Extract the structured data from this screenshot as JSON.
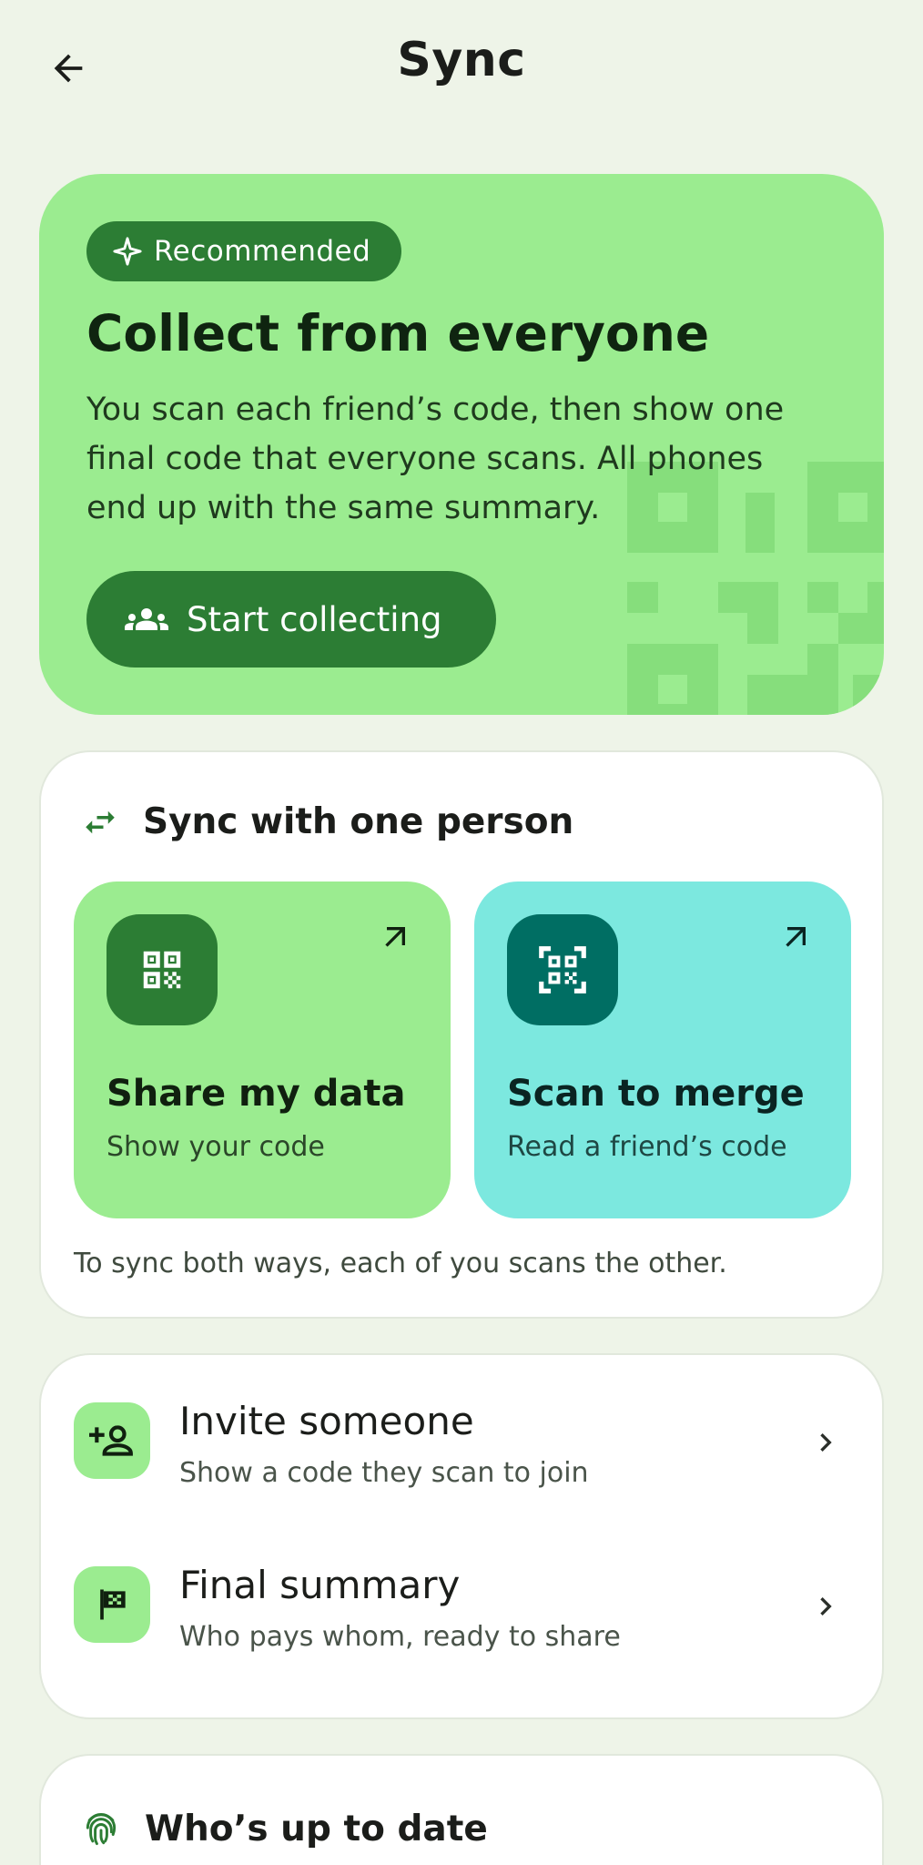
{
  "header": {
    "title": "Sync",
    "back_icon": "arrow-left-icon"
  },
  "hero": {
    "badge": "Recommended",
    "badge_icon": "sparkle-icon",
    "title": "Collect from everyone",
    "description": "You scan each friend’s code, then show one final code that everyone scans. All phones end up with the same summary.",
    "button_label": "Start collecting",
    "button_icon": "group-icon",
    "background_color": "#9BEC90",
    "accent_color": "#2C7D34"
  },
  "sync_one": {
    "title": "Sync with one person",
    "icon": "swap-arrows-icon",
    "tiles": [
      {
        "title": "Share my data",
        "subtitle": "Show your code",
        "icon": "qr-code-icon",
        "color": "#9BEC90"
      },
      {
        "title": "Scan to merge",
        "subtitle": "Read a friend’s code",
        "icon": "qr-scan-icon",
        "color": "#7CE8DF"
      }
    ],
    "note": "To sync both ways, each of you scans the other."
  },
  "list": [
    {
      "title": "Invite someone",
      "subtitle": "Show a code they scan to join",
      "icon": "person-add-icon"
    },
    {
      "title": "Final summary",
      "subtitle": "Who pays whom, ready to share",
      "icon": "flag-icon"
    }
  ],
  "up_to_date": {
    "title": "Who’s up to date",
    "icon": "fingerprint-icon"
  }
}
